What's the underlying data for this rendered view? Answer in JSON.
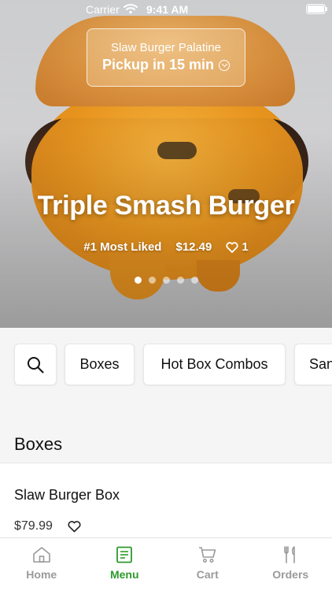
{
  "status_bar": {
    "carrier": "Carrier",
    "time": "9:41 AM"
  },
  "location": {
    "name": "Slaw Burger Palatine",
    "pickup": "Pickup in 15 min"
  },
  "hero": {
    "title": "Triple Smash Burger",
    "badge": "#1 Most Liked",
    "price": "$12.49",
    "likes": "1",
    "carousel_total": 5,
    "carousel_active": 1
  },
  "categories": {
    "items": [
      "Boxes",
      "Hot Box Combos",
      "San"
    ]
  },
  "section": {
    "title": "Boxes"
  },
  "menu_item": {
    "name": "Slaw Burger Box",
    "price": "$79.99"
  },
  "tabbar": {
    "items": [
      {
        "label": "Home",
        "icon": "home-icon"
      },
      {
        "label": "Menu",
        "icon": "menu-icon",
        "active": true
      },
      {
        "label": "Cart",
        "icon": "cart-icon"
      },
      {
        "label": "Orders",
        "icon": "fork-knife-icon"
      }
    ]
  },
  "colors": {
    "accent": "#2e9a2c",
    "inactive": "#9a9a9a"
  }
}
